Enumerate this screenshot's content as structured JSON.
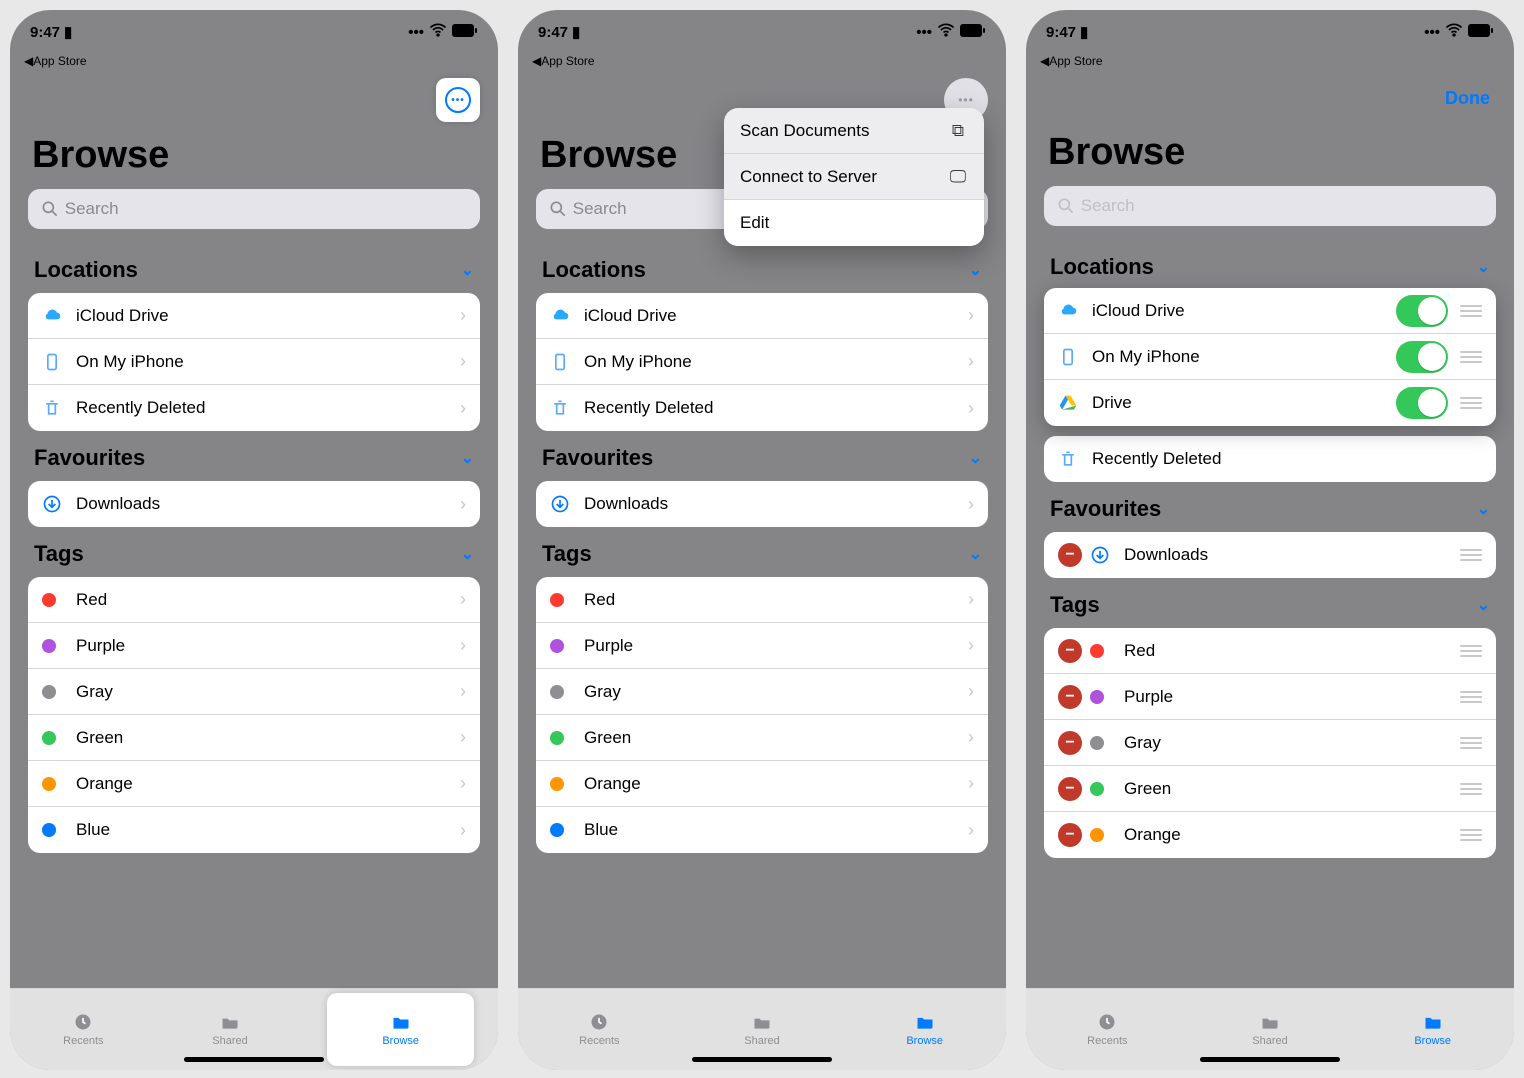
{
  "colors": {
    "accent": "#007aff",
    "green": "#34c759"
  },
  "status": {
    "time": "9:47",
    "back_app": "App Store"
  },
  "title": "Browse",
  "search_placeholder": "Search",
  "done": "Done",
  "sections": {
    "locations_header": "Locations",
    "favourites_header": "Favourites",
    "tags_header": "Tags"
  },
  "locations": [
    {
      "label": "iCloud Drive"
    },
    {
      "label": "On My iPhone"
    },
    {
      "label": "Recently Deleted"
    }
  ],
  "favourites": [
    {
      "label": "Downloads"
    }
  ],
  "tags": [
    {
      "label": "Red",
      "color": "#ff3b30"
    },
    {
      "label": "Purple",
      "color": "#af52de"
    },
    {
      "label": "Gray",
      "color": "#8e8e93"
    },
    {
      "label": "Green",
      "color": "#34c759"
    },
    {
      "label": "Orange",
      "color": "#ff9500"
    },
    {
      "label": "Blue",
      "color": "#007aff"
    }
  ],
  "tabbar": {
    "recents": "Recents",
    "shared": "Shared",
    "browse": "Browse"
  },
  "menu": {
    "scan": "Scan Documents",
    "connect": "Connect to Server",
    "edit": "Edit"
  },
  "edit_locations": [
    {
      "label": "iCloud Drive"
    },
    {
      "label": "On My iPhone"
    },
    {
      "label": "Drive"
    }
  ],
  "recently_deleted_label": "Recently Deleted",
  "edit_tags": [
    {
      "label": "Red",
      "color": "#ff3b30"
    },
    {
      "label": "Purple",
      "color": "#af52de"
    },
    {
      "label": "Gray",
      "color": "#8e8e93"
    },
    {
      "label": "Green",
      "color": "#34c759"
    },
    {
      "label": "Orange",
      "color": "#ff9500"
    }
  ]
}
